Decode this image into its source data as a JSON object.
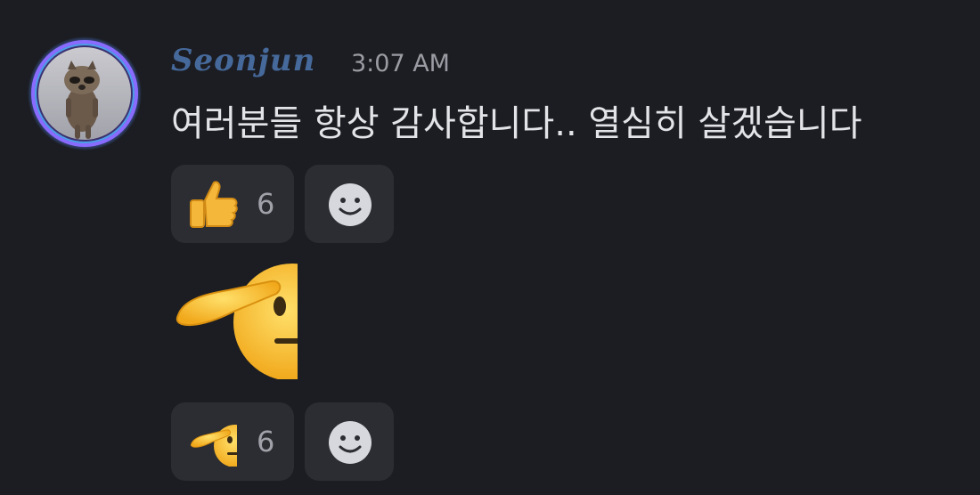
{
  "message": {
    "author": "Seonjun",
    "timestamp": "3:07 AM",
    "text": "여러분들 항상 감사합니다.. 열심히 살겠습니다"
  },
  "reactions_row1": [
    {
      "emoji": "thumbs-up-icon",
      "count": "6"
    }
  ],
  "reactions_row2": [
    {
      "emoji": "saluting-face-icon",
      "count": "6"
    }
  ],
  "colors": {
    "background": "#1c1d22",
    "username": "#46699b",
    "pill": "#2b2d33",
    "timestamp": "#9b9ca3"
  }
}
